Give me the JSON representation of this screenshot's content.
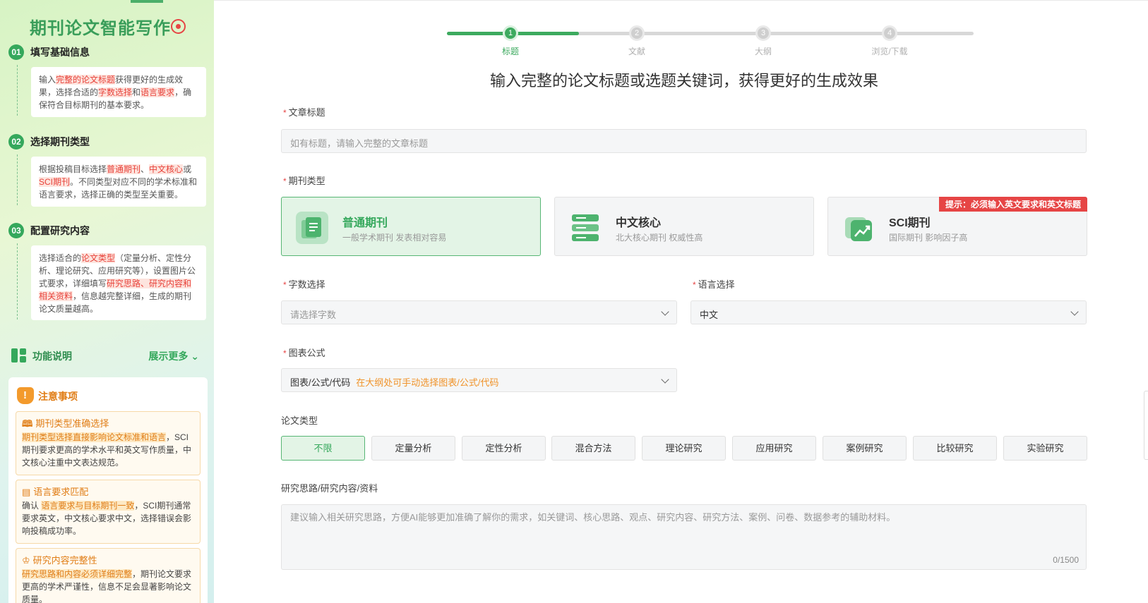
{
  "sidebar": {
    "title": "期刊论文智能写作",
    "steps": [
      {
        "num": "01",
        "title": "填写基础信息",
        "desc": [
          {
            "t": "输入"
          },
          {
            "t": "完整的论文标题",
            "hl": true
          },
          {
            "t": "获得更好的生成效果，选择合适的"
          },
          {
            "t": "字数选择",
            "hl": true
          },
          {
            "t": "和"
          },
          {
            "t": "语言要求",
            "hl": true
          },
          {
            "t": "，确保符合目标期刊的基本要求。"
          }
        ]
      },
      {
        "num": "02",
        "title": "选择期刊类型",
        "desc": [
          {
            "t": "根据投稿目标选择"
          },
          {
            "t": "普通期刊",
            "hl": true
          },
          {
            "t": "、"
          },
          {
            "t": "中文核心",
            "hl": true
          },
          {
            "t": "或"
          },
          {
            "t": "SCI期刊",
            "hl": true
          },
          {
            "t": "。不同类型对应不同的学术标准和语言要求，选择正确的类型至关重要。"
          }
        ]
      },
      {
        "num": "03",
        "title": "配置研究内容",
        "desc": [
          {
            "t": "选择适合的"
          },
          {
            "t": "论文类型",
            "hl": true
          },
          {
            "t": "（定量分析、定性分析、理论研究、应用研究等），设置图片公式要求，详细填写"
          },
          {
            "t": "研究思路、研究内容和相关资料",
            "hl": true
          },
          {
            "t": "，信息越完整详细，生成的期刊论文质量越高。"
          }
        ]
      }
    ],
    "func_label": "功能说明",
    "func_more": "展示更多",
    "notes_title": "注意事项",
    "notes": [
      {
        "icon": "book-icon",
        "glyph": "📖",
        "title": "期刊类型准确选择",
        "desc": [
          {
            "t": "期刊类型选择直接影响论文标准和语言",
            "hl": true
          },
          {
            "t": "，SCI期刊要求更高的学术水平和英文写作质量，中文核心注重中文表达规范。"
          }
        ]
      },
      {
        "icon": "document-icon",
        "glyph": "▤",
        "title": "语言要求匹配",
        "desc": [
          {
            "t": "确认 "
          },
          {
            "t": "语言要求与目标期刊一致",
            "hl": true
          },
          {
            "t": "，SCI期刊通常要求英文，中文核心要求中文，选择错误会影响投稿成功率。"
          }
        ]
      },
      {
        "icon": "graduation-cap-icon",
        "glyph": "🎓",
        "title": "研究内容完整性",
        "desc": [
          {
            "t": "研究思路和内容必须详细完整",
            "hl": true
          },
          {
            "t": "，期刊论文要求更高的学术严谨性，信息不足会显著影响论文质量。"
          }
        ]
      }
    ]
  },
  "progress": {
    "value": 0.25,
    "steps": [
      {
        "num": "1",
        "label": "标题",
        "active": true
      },
      {
        "num": "2",
        "label": "文献",
        "active": false
      },
      {
        "num": "3",
        "label": "大纲",
        "active": false
      },
      {
        "num": "4",
        "label": "浏览/下载",
        "active": false
      }
    ]
  },
  "headline": "输入完整的论文标题或选题关键词，获得更好的生成效果",
  "form": {
    "req_mark": "*",
    "title_label": "文章标题",
    "title_placeholder": "如有标题，请输入完整的文章标题",
    "journal_label": "期刊类型",
    "journals": [
      {
        "name": "普通期刊",
        "desc": "一般学术期刊 发表相对容易",
        "icon": "document-icon",
        "selected": true
      },
      {
        "name": "中文核心",
        "desc": "北大核心期刊 权威性高",
        "icon": "server-icon",
        "selected": false
      },
      {
        "name": "SCI期刊",
        "desc": "国际期刊 影响因子高",
        "icon": "chart-card-icon",
        "selected": false,
        "tip": "提示：必须输入英文要求和英文标题"
      }
    ],
    "words_label": "字数选择",
    "words_placeholder": "请选择字数",
    "lang_label": "语言选择",
    "lang_value": "中文",
    "chart_label": "图表公式",
    "chart_value": "图表/公式/代码",
    "chart_hint": "在大纲处可手动选择图表/公式/代码",
    "ptype_label": "论文类型",
    "ptypes": [
      "不限",
      "定量分析",
      "定性分析",
      "混合方法",
      "理论研究",
      "应用研究",
      "案例研究",
      "比较研究",
      "实验研究"
    ],
    "ptype_selected": "不限",
    "research_label": "研究思路/研究内容/资料",
    "research_placeholder": "建议输入相关研究思路，方便AI能够更加准确了解你的需求，如关键词、核心思路、观点、研究内容、研究方法、案例、问卷、数据参考的辅助材料。",
    "counter": "0/1500"
  },
  "colors": {
    "accent": "#3daa5f",
    "warning": "#e64545",
    "orange": "#f0932a"
  }
}
